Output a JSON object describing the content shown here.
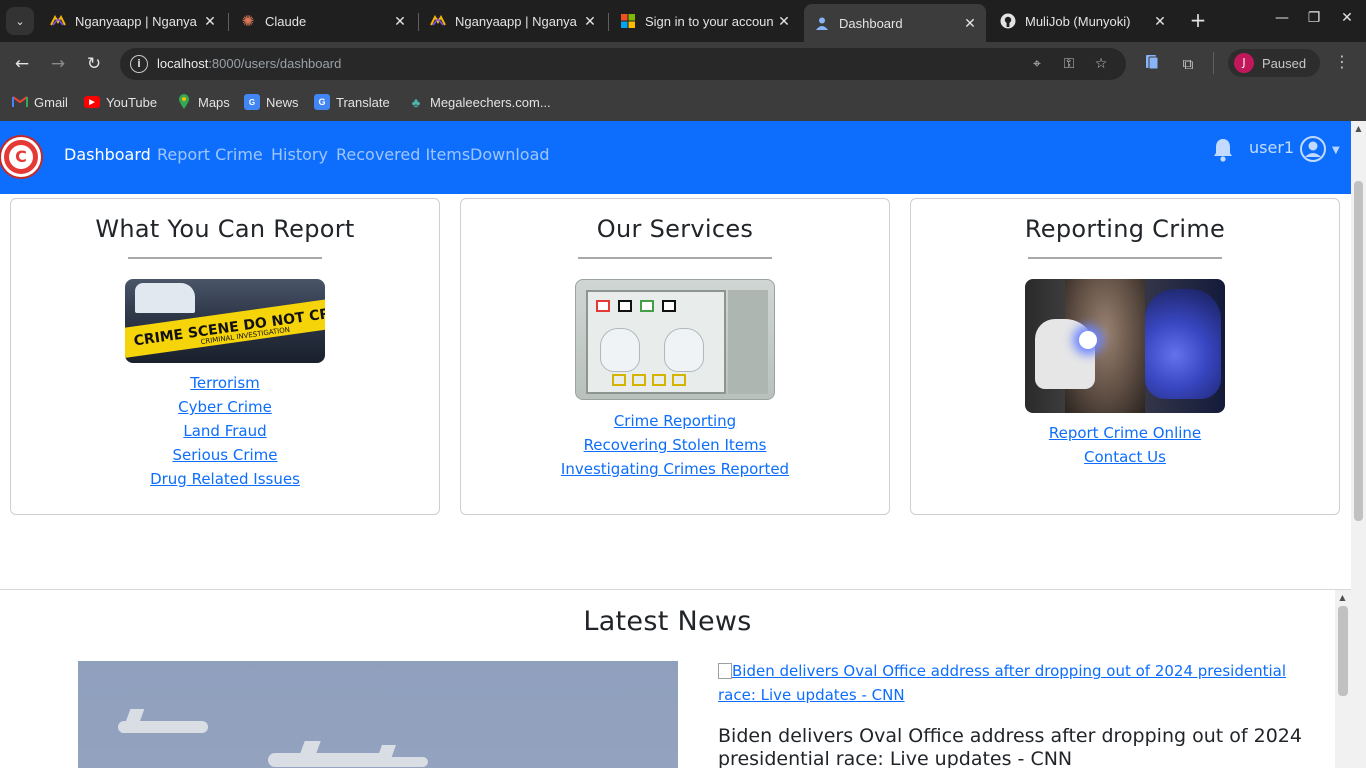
{
  "browser": {
    "tabs": [
      {
        "title": "Nganyaapp | Nganya",
        "icon": "nganya-icon"
      },
      {
        "title": "Claude",
        "icon": "claude-icon"
      },
      {
        "title": "Nganyaapp | Nganya",
        "icon": "nganya-icon"
      },
      {
        "title": "Sign in to your account",
        "icon": "microsoft-icon"
      },
      {
        "title": "Dashboard",
        "icon": "dashboard-icon",
        "active": true
      },
      {
        "title": "MuliJob (Munyoki)",
        "icon": "github-icon"
      }
    ],
    "url_host": "localhost",
    "url_path": ":8000/users/dashboard",
    "profile_initial": "J",
    "profile_status": "Paused",
    "bookmarks": [
      {
        "label": "Gmail",
        "icon": "gmail-icon"
      },
      {
        "label": "YouTube",
        "icon": "youtube-icon"
      },
      {
        "label": "Maps",
        "icon": "maps-icon"
      },
      {
        "label": "News",
        "icon": "news-icon"
      },
      {
        "label": "Translate",
        "icon": "translate-icon"
      },
      {
        "label": "Megaleechers.com...",
        "icon": "megaleechers-icon"
      }
    ]
  },
  "nav": {
    "links": [
      "Dashboard",
      "Report Crime",
      "History",
      "Recovered Items",
      "Download"
    ],
    "active": "Dashboard",
    "username": "user1",
    "brand_color": "#0d6efd"
  },
  "cards": [
    {
      "title": "What You Can Report",
      "image": "crime-scene-image",
      "image_text": "CRIME SCENE DO NOT CR",
      "image_subtext": "CRIMINAL INVESTIGATION",
      "links": [
        "Terrorism",
        "Cyber Crime",
        "Land Fraud",
        "Serious Crime",
        "Drug Related Issues"
      ]
    },
    {
      "title": "Our Services",
      "image": "fingerprint-scanner-image",
      "links": [
        "Crime Reporting",
        "Recovering Stolen Items",
        "Investigating Crimes Reported"
      ]
    },
    {
      "title": "Reporting Crime",
      "image": "forensic-investigation-image",
      "links": [
        "Report Crime Online",
        "Contact Us"
      ]
    }
  ],
  "news": {
    "title": "Latest News",
    "link_text": "Biden delivers Oval Office address after dropping out of 2024 presidential race: Live updates - CNN",
    "headline": "Biden delivers Oval Office address after dropping out of 2024 presidential race: Live updates - CNN"
  }
}
